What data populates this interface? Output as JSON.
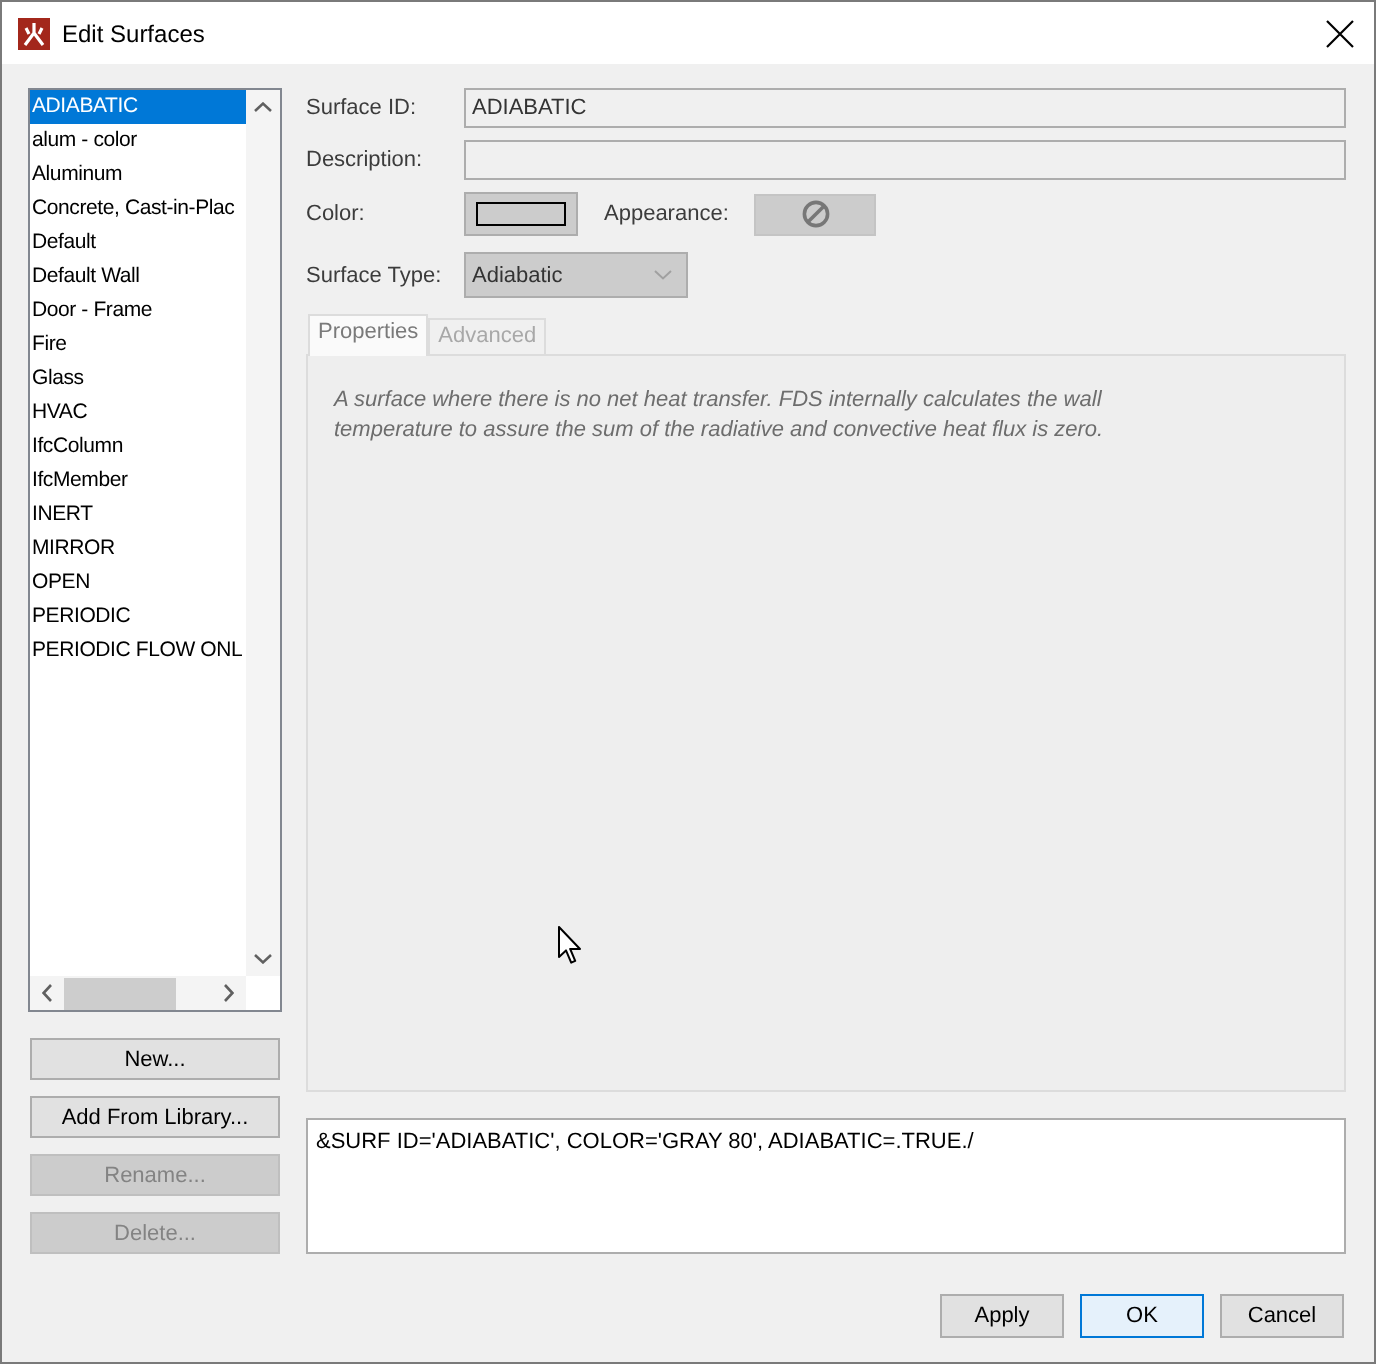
{
  "window": {
    "title": "Edit Surfaces"
  },
  "surfaces": [
    {
      "label": "ADIABATIC",
      "selected": true
    },
    {
      "label": "alum - color",
      "selected": false
    },
    {
      "label": "Aluminum",
      "selected": false
    },
    {
      "label": "Concrete, Cast-in-Plac",
      "selected": false
    },
    {
      "label": "Default",
      "selected": false
    },
    {
      "label": "Default Wall",
      "selected": false
    },
    {
      "label": "Door - Frame",
      "selected": false
    },
    {
      "label": "Fire",
      "selected": false
    },
    {
      "label": "Glass",
      "selected": false
    },
    {
      "label": "HVAC",
      "selected": false
    },
    {
      "label": "IfcColumn",
      "selected": false
    },
    {
      "label": "IfcMember",
      "selected": false
    },
    {
      "label": "INERT",
      "selected": false
    },
    {
      "label": "MIRROR",
      "selected": false
    },
    {
      "label": "OPEN",
      "selected": false
    },
    {
      "label": "PERIODIC",
      "selected": false
    },
    {
      "label": "PERIODIC FLOW ONL",
      "selected": false
    }
  ],
  "list_buttons": [
    {
      "label": "New...",
      "disabled": false
    },
    {
      "label": "Add From Library...",
      "disabled": false
    },
    {
      "label": "Rename...",
      "disabled": true
    },
    {
      "label": "Delete...",
      "disabled": true
    }
  ],
  "form": {
    "surface_id": {
      "label": "Surface ID:",
      "value": "ADIABATIC",
      "disabled": true
    },
    "description": {
      "label": "Description:",
      "disabled": true
    },
    "color": {
      "label": "Color:",
      "color": "#cccccc",
      "disabled": true
    },
    "appearance": {
      "label": "Appearance:",
      "disabled": true
    },
    "surface_type": {
      "label": "Surface Type:",
      "value": "Adiabatic",
      "disabled": true
    }
  },
  "tabs": [
    {
      "label": "Properties",
      "selected": true,
      "disabled": false
    },
    {
      "label": "Advanced",
      "selected": false,
      "disabled": true
    }
  ],
  "properties_text": "A surface where there is no net heat transfer. FDS internally calculates the wall temperature to assure the sum of the radiative and convective heat flux is zero.",
  "fds_record": "&SURF ID='ADIABATIC', COLOR='GRAY 80', ADIABATIC=.TRUE./",
  "buttons": [
    {
      "label": "Apply",
      "focused": false
    },
    {
      "label": "OK",
      "focused": true
    },
    {
      "label": "Cancel",
      "focused": false
    }
  ]
}
